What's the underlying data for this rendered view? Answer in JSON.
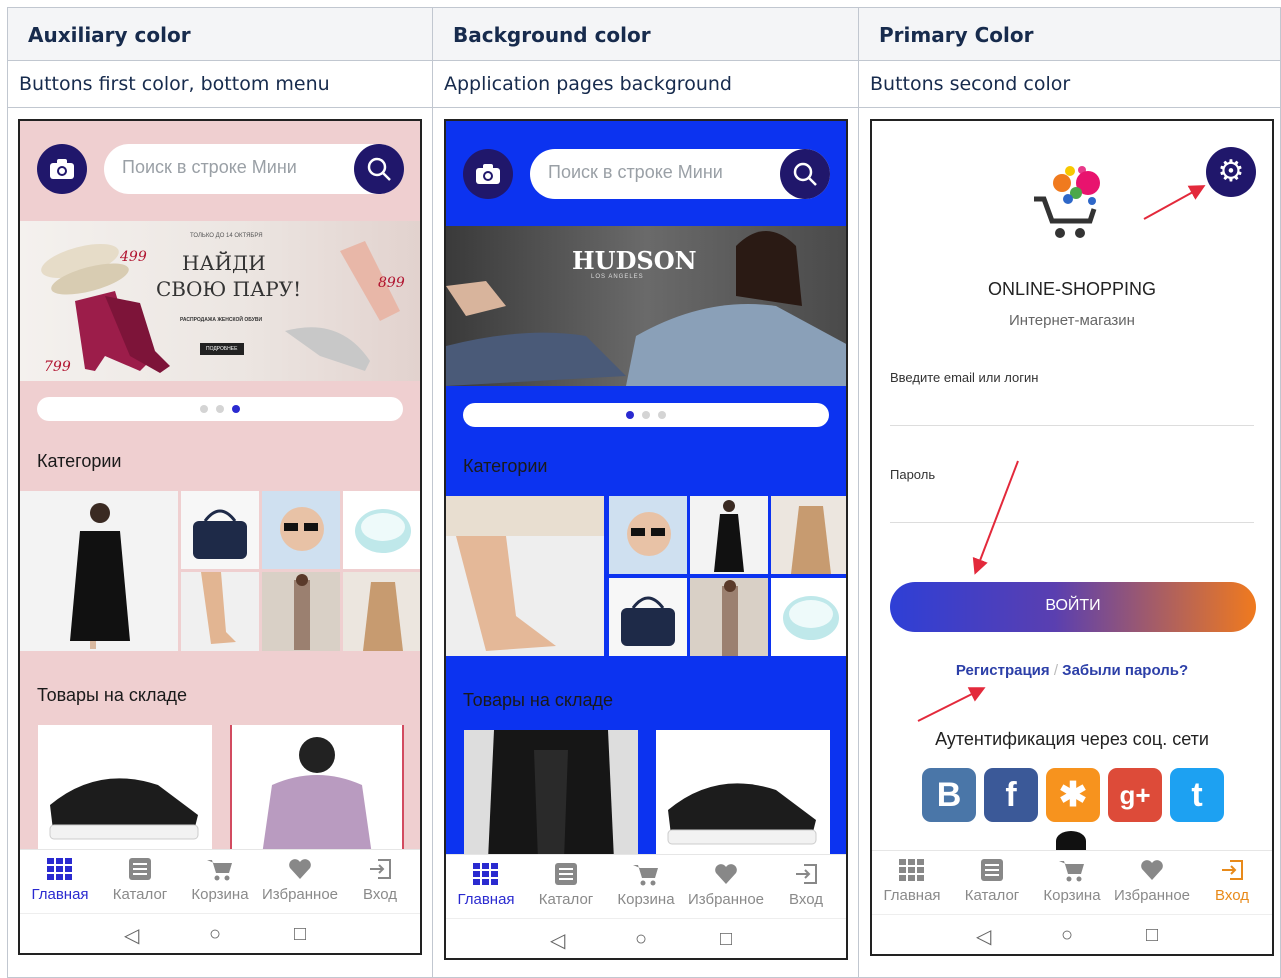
{
  "columns": [
    {
      "header": "Auxiliary color",
      "description": "Buttons first color, bottom menu"
    },
    {
      "header": "Background color",
      "description": "Application pages background"
    },
    {
      "header": "Primary Color",
      "description": "Buttons second color"
    }
  ],
  "search": {
    "placeholder": "Поиск в строке Мини"
  },
  "banner1": {
    "small_top": "ТОЛЬКО ДО 14 ОКТЯБРЯ",
    "headline1": "НАЙДИ",
    "headline2": "СВОЮ ПАРУ!",
    "sale": "РАСПРОДАЖА ЖЕНСКОЙ ОБУВИ",
    "button": "ПОДРОБНЕЕ",
    "price_a": "499",
    "price_b": "799",
    "price_c": "899"
  },
  "banner2": {
    "brand": "HUDSON",
    "sub": "LOS ANGELES"
  },
  "sections": {
    "categories": "Категории",
    "stock": "Товары на складе"
  },
  "nav": {
    "home": "Главная",
    "catalog": "Каталог",
    "cart": "Корзина",
    "favorites": "Избранное",
    "login": "Вход"
  },
  "login": {
    "app_name": "ONLINE-SHOPPING",
    "subtitle": "Интернет-магазин",
    "email_label": "Введите email или логин",
    "password_label": "Пароль",
    "submit": "ВОЙТИ",
    "register": "Регистрация",
    "separator": "/",
    "forgot": "Забыли пароль?",
    "social_title": "Аутентификация через соц. сети"
  },
  "colors": {
    "auxiliary_bg": "#efcfd0",
    "background_blue": "#0c33f0",
    "primary_navy": "#20176b",
    "button_gradient_start": "#2e3fd6",
    "button_gradient_end": "#f07a1e",
    "active_nav": "#2a2ad0",
    "login_active": "#e88a1a",
    "arrow_red": "#e3293b"
  }
}
